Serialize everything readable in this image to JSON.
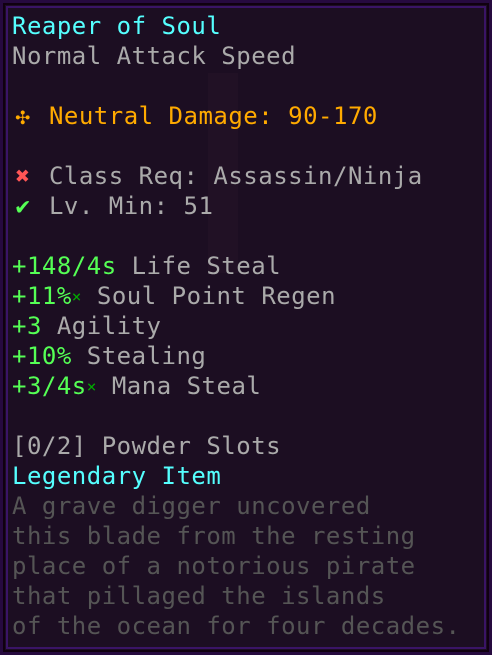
{
  "item": {
    "name": "Reaper of Soul",
    "attack_speed": "Normal Attack Speed",
    "damage": {
      "icon": "neutral-damage-icon",
      "icon_glyph": "✣",
      "label": "Neutral Damage: 90-170"
    },
    "requirements": {
      "class_icon": "cross-icon",
      "class_glyph": "✖",
      "class_text": "Class Req: Assassin/Ninja",
      "level_icon": "check-icon",
      "level_glyph": "✔",
      "level_text": "Lv. Min: 51"
    },
    "identifications": [
      {
        "value": "+148/4s",
        "suffix": "",
        "label": "Life Steal"
      },
      {
        "value": "+11%",
        "suffix": "×",
        "label": "Soul Point Regen"
      },
      {
        "value": "+3",
        "suffix": "",
        "label": "Agility"
      },
      {
        "value": "+10%",
        "suffix": "",
        "label": "Stealing"
      },
      {
        "value": "+3/4s",
        "suffix": "×",
        "label": "Mana Steal"
      }
    ],
    "powder_slots": "[0/2] Powder Slots",
    "tier": "Legendary Item",
    "lore": [
      "A grave digger uncovered",
      "this blade from the resting",
      "place of a notorious pirate",
      "that pillaged the islands",
      "of the ocean for four decades."
    ]
  },
  "colors": {
    "name": "#55ffff",
    "damage": "#ffaa00",
    "positive": "#55ff55",
    "requirement_fail": "#ff5555",
    "requirement_pass": "#55ff55",
    "lore": "#555555",
    "background": "#1c0e22",
    "border": "#3a1466"
  }
}
